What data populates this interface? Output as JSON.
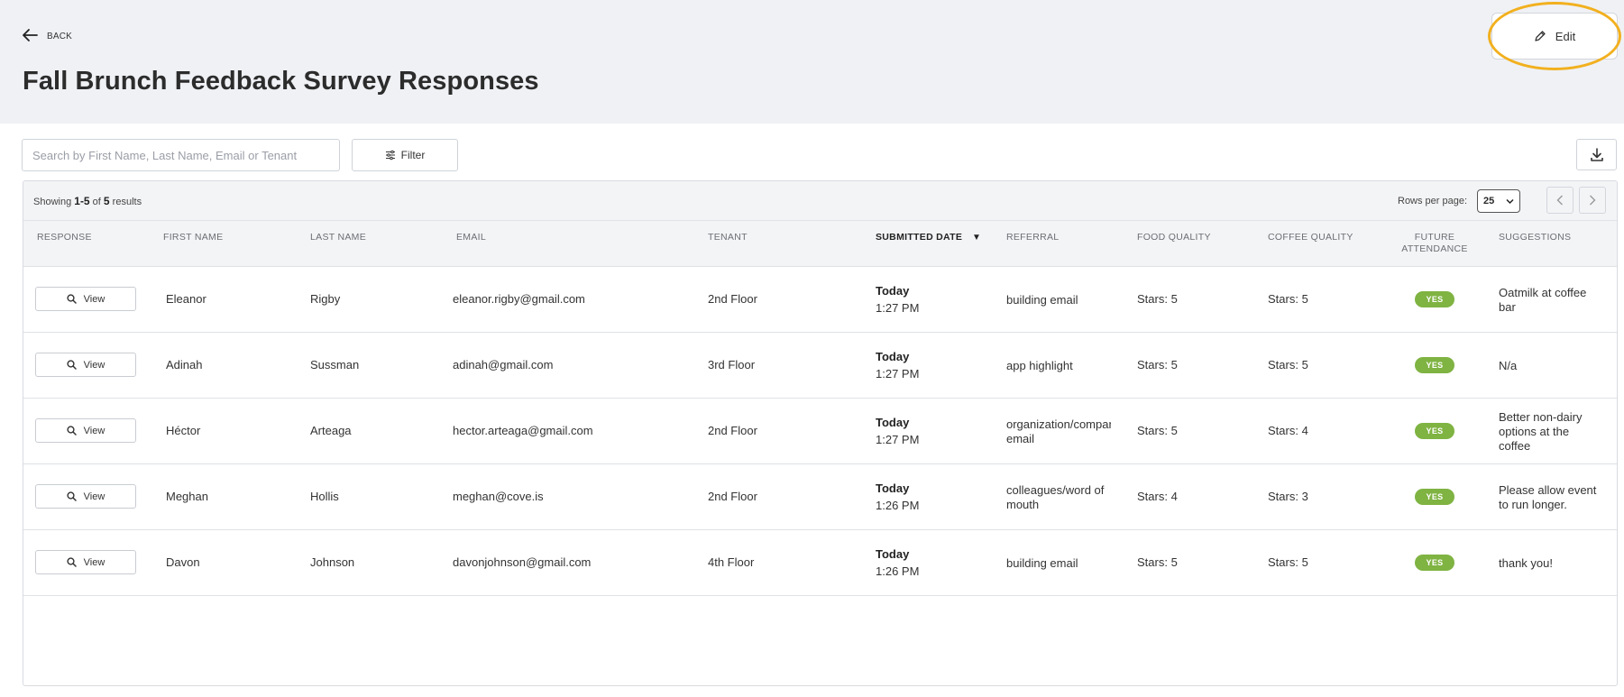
{
  "header": {
    "back_label": "BACK",
    "title": "Fall Brunch Feedback Survey Responses",
    "edit_label": "Edit"
  },
  "toolbar": {
    "search_placeholder": "Search by First Name, Last Name, Email or Tenant",
    "filter_label": "Filter"
  },
  "table": {
    "results_prefix": "Showing",
    "results_range": "1-5",
    "results_of": "of",
    "results_total": "5",
    "results_suffix": "results",
    "rows_per_page_label": "Rows per page:",
    "rows_per_page_value": "25",
    "columns": {
      "response": "RESPONSE",
      "first_name": "FIRST NAME",
      "last_name": "LAST NAME",
      "email": "EMAIL",
      "tenant": "TENANT",
      "submitted_date": "SUBMITTED DATE",
      "referral": "REFERRAL",
      "food_quality": "FOOD QUALITY",
      "coffee_quality": "COFFEE QUALITY",
      "future_attendance_1": "FUTURE",
      "future_attendance_2": "ATTENDANCE",
      "suggestions": "SUGGESTIONS"
    },
    "sort_indicator": "▼",
    "view_label": "View",
    "rows": [
      {
        "first_name": "Eleanor",
        "last_name": "Rigby",
        "email": "eleanor.rigby@gmail.com",
        "tenant": "2nd Floor",
        "date_day": "Today",
        "date_time": "1:27 PM",
        "referral": "building email",
        "food_quality": "Stars: 5",
        "coffee_quality": "Stars: 5",
        "future_attendance": "YES",
        "suggestions": "Oatmilk at coffee bar"
      },
      {
        "first_name": "Adinah",
        "last_name": "Sussman",
        "email": "adinah@gmail.com",
        "tenant": "3rd Floor",
        "date_day": "Today",
        "date_time": "1:27 PM",
        "referral": "app highlight",
        "food_quality": "Stars: 5",
        "coffee_quality": "Stars: 5",
        "future_attendance": "YES",
        "suggestions": "N/a"
      },
      {
        "first_name": "Héctor",
        "last_name": "Arteaga",
        "email": "hector.arteaga@gmail.com",
        "tenant": "2nd Floor",
        "date_day": "Today",
        "date_time": "1:27 PM",
        "referral": "organization/company email",
        "food_quality": "Stars: 5",
        "coffee_quality": "Stars: 4",
        "future_attendance": "YES",
        "suggestions": "Better non-dairy options at the coffee"
      },
      {
        "first_name": "Meghan",
        "last_name": "Hollis",
        "email": "meghan@cove.is",
        "tenant": "2nd Floor",
        "date_day": "Today",
        "date_time": "1:26 PM",
        "referral": "colleagues/word of mouth",
        "food_quality": "Stars: 4",
        "coffee_quality": "Stars: 3",
        "future_attendance": "YES",
        "suggestions": "Please allow event to run longer."
      },
      {
        "first_name": "Davon",
        "last_name": "Johnson",
        "email": "davonjohnson@gmail.com",
        "tenant": "4th Floor",
        "date_day": "Today",
        "date_time": "1:26 PM",
        "referral": "building email",
        "food_quality": "Stars: 5",
        "coffee_quality": "Stars: 5",
        "future_attendance": "YES",
        "suggestions": "thank you!"
      }
    ]
  },
  "colors": {
    "header_bg": "#eff1f5",
    "badge_green": "#7fb342",
    "highlight_ring": "#f2b01e"
  },
  "icons": [
    "arrow-left-icon",
    "pencil-icon",
    "sliders-icon",
    "download-icon",
    "search-icon",
    "chevron-left-icon",
    "chevron-right-icon",
    "chevron-down-icon",
    "sort-down-icon"
  ]
}
